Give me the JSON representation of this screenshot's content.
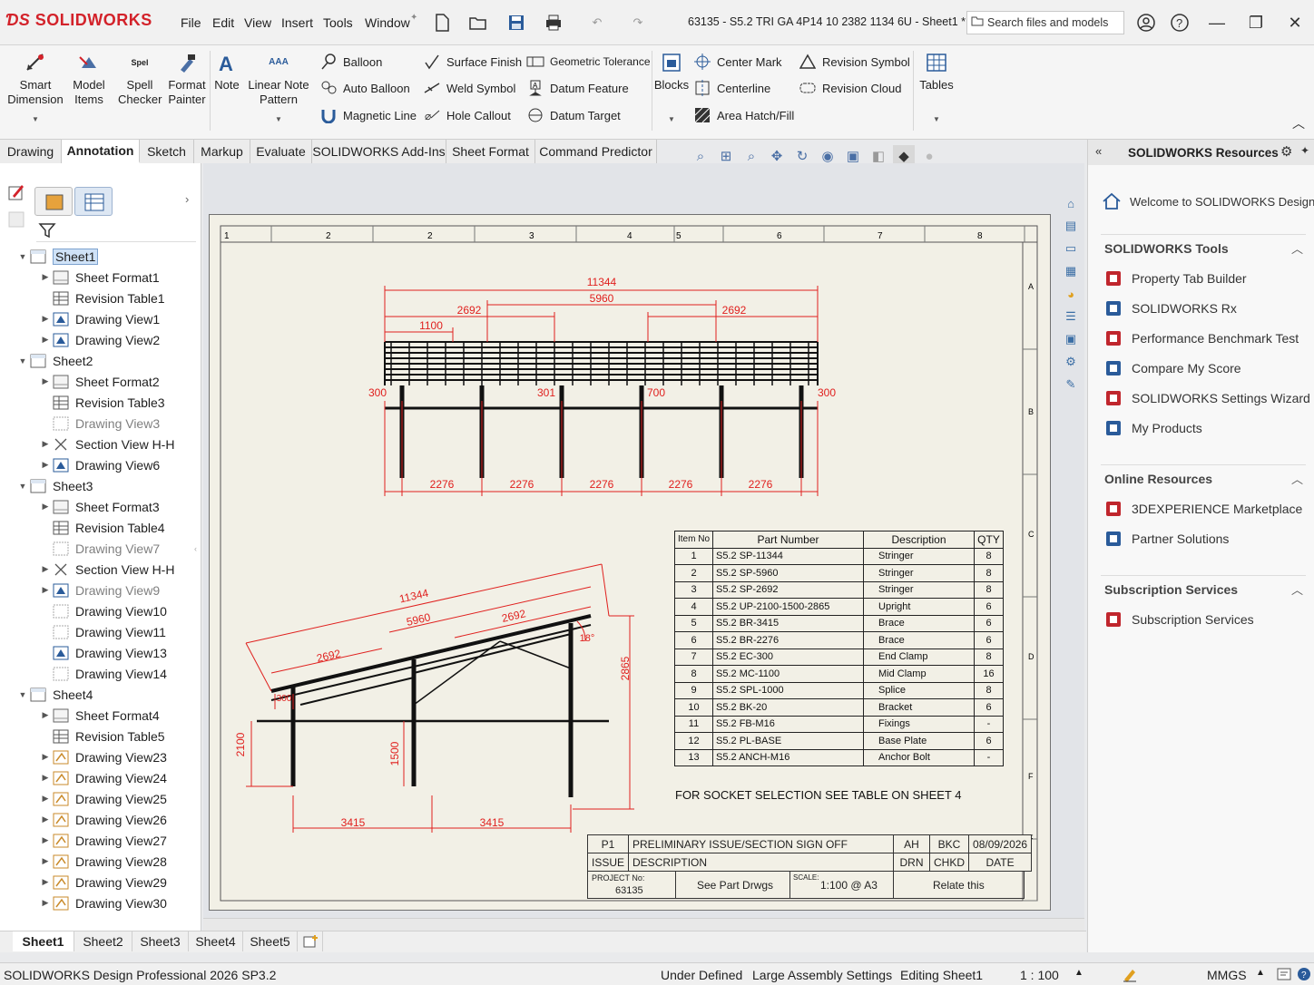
{
  "app": {
    "brand": "SOLIDWORKS",
    "doc_title": "63135 - S5.2 TRI GA 4P14 10 2382 1134 6U - Sheet1 *"
  },
  "menus": [
    "File",
    "Edit",
    "View",
    "Insert",
    "Tools",
    "Window"
  ],
  "search": {
    "placeholder": "Search files and models"
  },
  "ribbon": {
    "smart_dimension": [
      "Smart",
      "Dimension"
    ],
    "model_items": [
      "Model",
      "Items"
    ],
    "spell_checker": [
      "Spell",
      "Checker"
    ],
    "spell_icon_text": "Spel",
    "format_painter": [
      "Format",
      "Painter"
    ],
    "note": "Note",
    "linear_note_pattern": [
      "Linear Note",
      "Pattern"
    ],
    "balloon": "Balloon",
    "auto_balloon": "Auto Balloon",
    "magnetic_line": "Magnetic Line",
    "surface_finish": "Surface Finish",
    "weld_symbol": "Weld Symbol",
    "hole_callout": "Hole Callout",
    "geometric_tolerance": "Geometric Tolerance",
    "datum_feature": "Datum Feature",
    "datum_target": "Datum Target",
    "blocks": "Blocks",
    "center_mark": "Center Mark",
    "centerline": "Centerline",
    "area_hatch": "Area Hatch/Fill",
    "revision_symbol": "Revision Symbol",
    "revision_cloud": "Revision Cloud",
    "tables": "Tables"
  },
  "tabs": [
    "Drawing",
    "Annotation",
    "Sketch",
    "Markup",
    "Evaluate",
    "SOLIDWORKS Add-Ins",
    "Sheet Format",
    "Command Predictor"
  ],
  "tree": [
    {
      "label": "Sheet1",
      "level": 0,
      "exp": "open",
      "icon": "sheet",
      "sel": true
    },
    {
      "label": "Sheet Format1",
      "level": 1,
      "exp": "closed",
      "icon": "sheet-format"
    },
    {
      "label": "Revision Table1",
      "level": 1,
      "exp": "none",
      "icon": "table"
    },
    {
      "label": "Drawing View1",
      "level": 1,
      "exp": "closed",
      "icon": "view"
    },
    {
      "label": "Drawing View2",
      "level": 1,
      "exp": "closed",
      "icon": "view"
    },
    {
      "label": "Sheet2",
      "level": 0,
      "exp": "open",
      "icon": "sheet"
    },
    {
      "label": "Sheet Format2",
      "level": 1,
      "exp": "closed",
      "icon": "sheet-format"
    },
    {
      "label": "Revision Table3",
      "level": 1,
      "exp": "none",
      "icon": "table"
    },
    {
      "label": "Drawing View3",
      "level": 1,
      "exp": "none",
      "icon": "view-empty",
      "grey": true
    },
    {
      "label": "Section View H-H",
      "level": 1,
      "exp": "closed",
      "icon": "section"
    },
    {
      "label": "Drawing View6",
      "level": 1,
      "exp": "closed",
      "icon": "view"
    },
    {
      "label": "Sheet3",
      "level": 0,
      "exp": "open",
      "icon": "sheet"
    },
    {
      "label": "Sheet Format3",
      "level": 1,
      "exp": "closed",
      "icon": "sheet-format"
    },
    {
      "label": "Revision Table4",
      "level": 1,
      "exp": "none",
      "icon": "table"
    },
    {
      "label": "Drawing View7",
      "level": 1,
      "exp": "none",
      "icon": "view-empty",
      "grey": true
    },
    {
      "label": "Section View H-H",
      "level": 1,
      "exp": "closed",
      "icon": "section"
    },
    {
      "label": "Drawing View9",
      "level": 1,
      "exp": "closed",
      "icon": "view",
      "grey": true
    },
    {
      "label": "Drawing View10",
      "level": 1,
      "exp": "none",
      "icon": "view-empty"
    },
    {
      "label": "Drawing View11",
      "level": 1,
      "exp": "none",
      "icon": "view-empty"
    },
    {
      "label": "Drawing View13",
      "level": 1,
      "exp": "none",
      "icon": "view"
    },
    {
      "label": "Drawing View14",
      "level": 1,
      "exp": "none",
      "icon": "view-empty"
    },
    {
      "label": "Sheet4",
      "level": 0,
      "exp": "open",
      "icon": "sheet"
    },
    {
      "label": "Sheet Format4",
      "level": 1,
      "exp": "closed",
      "icon": "sheet-format"
    },
    {
      "label": "Revision Table5",
      "level": 1,
      "exp": "none",
      "icon": "table"
    },
    {
      "label": "Drawing View23",
      "level": 1,
      "exp": "closed",
      "icon": "view-iso"
    },
    {
      "label": "Drawing View24",
      "level": 1,
      "exp": "closed",
      "icon": "view-iso"
    },
    {
      "label": "Drawing View25",
      "level": 1,
      "exp": "closed",
      "icon": "view-iso"
    },
    {
      "label": "Drawing View26",
      "level": 1,
      "exp": "closed",
      "icon": "view-iso"
    },
    {
      "label": "Drawing View27",
      "level": 1,
      "exp": "closed",
      "icon": "view-iso"
    },
    {
      "label": "Drawing View28",
      "level": 1,
      "exp": "closed",
      "icon": "view-iso"
    },
    {
      "label": "Drawing View29",
      "level": 1,
      "exp": "closed",
      "icon": "view-iso"
    },
    {
      "label": "Drawing View30",
      "level": 1,
      "exp": "closed",
      "icon": "view-iso"
    }
  ],
  "drawing": {
    "col_labels": [
      "1",
      "2",
      "2",
      "3",
      "4",
      "5",
      "6",
      "7",
      "8"
    ],
    "row_labels": [
      "A",
      "B",
      "C",
      "D",
      "F",
      "F"
    ],
    "top_view_dims": {
      "overall": "11344",
      "inner": "5960",
      "left": "2692",
      "right": "2692",
      "small": "1100",
      "ov_left": "300",
      "ov_mid1": "301",
      "ov_mid2": "700",
      "ov_right": "300",
      "spacing": [
        "2276",
        "2276",
        "2276",
        "2276",
        "2276"
      ]
    },
    "iso_view_dims": {
      "overall": "11344",
      "inner": "5960",
      "right": "2692",
      "left": "2692",
      "angle": "18°",
      "small": "300",
      "height_right": "2865",
      "height_left": "2100",
      "height_mid": "1500",
      "spacing": [
        "3415",
        "3415"
      ]
    },
    "bom": {
      "headers": [
        "Item No",
        "Part Number",
        "Description",
        "QTY"
      ],
      "rows": [
        [
          "1",
          "S5.2 SP-11344",
          "Stringer",
          "8"
        ],
        [
          "2",
          "S5.2 SP-5960",
          "Stringer",
          "8"
        ],
        [
          "3",
          "S5.2 SP-2692",
          "Stringer",
          "8"
        ],
        [
          "4",
          "S5.2 UP-2100-1500-2865",
          "Upright",
          "6"
        ],
        [
          "5",
          "S5.2 BR-3415",
          "Brace",
          "6"
        ],
        [
          "6",
          "S5.2 BR-2276",
          "Brace",
          "6"
        ],
        [
          "7",
          "S5.2 EC-300",
          "End Clamp",
          "8"
        ],
        [
          "8",
          "S5.2 MC-1100",
          "Mid Clamp",
          "16"
        ],
        [
          "9",
          "S5.2 SPL-1000",
          "Splice",
          "8"
        ],
        [
          "10",
          "S5.2 BK-20",
          "Bracket",
          "6"
        ],
        [
          "11",
          "S5.2 FB-M16",
          "Fixings",
          "-"
        ],
        [
          "12",
          "S5.2 PL-BASE",
          "Base Plate",
          "6"
        ],
        [
          "13",
          "S5.2 ANCH-M16",
          "Anchor Bolt",
          "-"
        ]
      ]
    },
    "note": "FOR SOCKET SELECTION SEE TABLE ON SHEET 4",
    "title_block": {
      "rev": "P1",
      "rev_desc": "PRELIMINARY ISSUE/SECTION SIGN OFF",
      "drn": "AH",
      "chkd": "BKC",
      "date": "08/09/2026",
      "h_issue": "ISSUE",
      "h_desc": "DESCRIPTION",
      "h_drn": "DRN",
      "h_chkd": "CHKD",
      "h_date": "DATE",
      "project_lbl": "PROJECT No:",
      "project_no": "63135",
      "drawings": "See Part Drwgs",
      "scale_lbl": "SCALE:",
      "scale": "1:100 @ A3",
      "relate": "Relate this"
    }
  },
  "taskpane": {
    "title": "SOLIDWORKS Resources",
    "welcome": "Welcome to SOLIDWORKS Design",
    "tools_header": "SOLIDWORKS Tools",
    "tools": [
      "Property Tab Builder",
      "SOLIDWORKS Rx",
      "Performance Benchmark Test",
      "Compare My Score",
      "SOLIDWORKS Settings Wizard",
      "My Products"
    ],
    "online_header": "Online Resources",
    "online": [
      "3DEXPERIENCE Marketplace",
      "Partner Solutions"
    ],
    "subs_header": "Subscription Services",
    "subs": [
      "Subscription Services"
    ]
  },
  "sheet_tabs": [
    "Sheet1",
    "Sheet2",
    "Sheet3",
    "Sheet4",
    "Sheet5"
  ],
  "status": {
    "product": "SOLIDWORKS Design Professional 2026 SP3.2",
    "defined": "Under Defined",
    "large_assembly": "Large Assembly Settings",
    "editing": "Editing Sheet1",
    "scale": "1 : 100",
    "units": "MMGS"
  },
  "colors": {
    "accent": "#d3222a",
    "dim": "#e0201e",
    "brand_blue": "#3b6ea5",
    "sheet_bg": "#f2f0e6"
  }
}
